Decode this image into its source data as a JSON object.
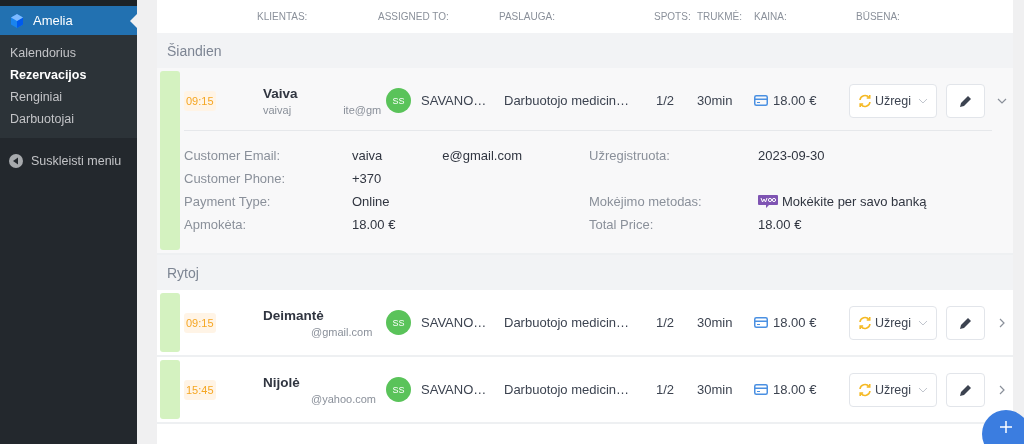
{
  "sidebar": {
    "plugin": {
      "title": "Amelia",
      "selected": true
    },
    "items": [
      {
        "label": "Kalendorius",
        "selected": false
      },
      {
        "label": "Rezervacijos",
        "selected": true
      },
      {
        "label": "Renginiai",
        "selected": false
      },
      {
        "label": "Darbuotojai",
        "selected": false
      }
    ],
    "collapse": {
      "label": "Suskleisti meniu"
    }
  },
  "table": {
    "columns": [
      {
        "label": "KLIENTAS:"
      },
      {
        "label": "ASSIGNED TO:"
      },
      {
        "label": "PASLAUGA:"
      },
      {
        "label": "SPOTS:"
      },
      {
        "label": "TRUKMĖ:"
      },
      {
        "label": "KAINA:"
      },
      {
        "label": "BŪSENA:"
      }
    ],
    "groups": [
      {
        "title": "Šiandien",
        "rows": [
          {
            "time": "09:15",
            "name": "Vaiva",
            "email_start": "vaivaj",
            "email_end": "ite@gm",
            "employee_initials": "SS",
            "employee": "SAVANO…",
            "service": "Darbuotojo medicin…",
            "spots": "1/2",
            "duration": "30min",
            "price": "18.00 €",
            "status": "Užregi",
            "expanded": true,
            "details": [
              {
                "label": "Customer Email:",
                "value_parts": [
                  "vaiva",
                  "e@gmail.com"
                ]
              },
              {
                "label": "Užregistruota:",
                "value_parts": [
                  "2023-09-30"
                ]
              },
              {
                "label": "Customer Phone:",
                "value_parts": [
                  "+370"
                ]
              },
              {
                "kind": "blank"
              },
              {
                "label": "Payment Type:",
                "value_parts": [
                  "Online"
                ]
              },
              {
                "label": "Mokėjimo metodas:",
                "value_parts": [
                  "Mokėkite per savo banką"
                ],
                "kind": "payment"
              },
              {
                "label": "Apmokėta:",
                "value_parts": [
                  "18.00 €"
                ]
              },
              {
                "label": "Total Price:",
                "value_parts": [
                  "18.00 €"
                ]
              }
            ]
          }
        ]
      },
      {
        "title": "Rytoj",
        "rows": [
          {
            "time": "09:15",
            "name": "Deimantė",
            "email_end": "@gmail.com",
            "employee_initials": "SS",
            "employee": "SAVANO…",
            "service": "Darbuotojo medicin…",
            "spots": "1/2",
            "duration": "30min",
            "price": "18.00 €",
            "status": "Užregi",
            "expanded": false
          },
          {
            "time": "15:45",
            "name": "Nijolė",
            "email_end": "@yahoo.com",
            "employee_initials": "SS",
            "employee": "SAVANO…",
            "service": "Darbuotojo medicin…",
            "spots": "1/2",
            "duration": "30min",
            "price": "18.00 €",
            "status": "Užregi",
            "expanded": false
          }
        ]
      }
    ]
  }
}
